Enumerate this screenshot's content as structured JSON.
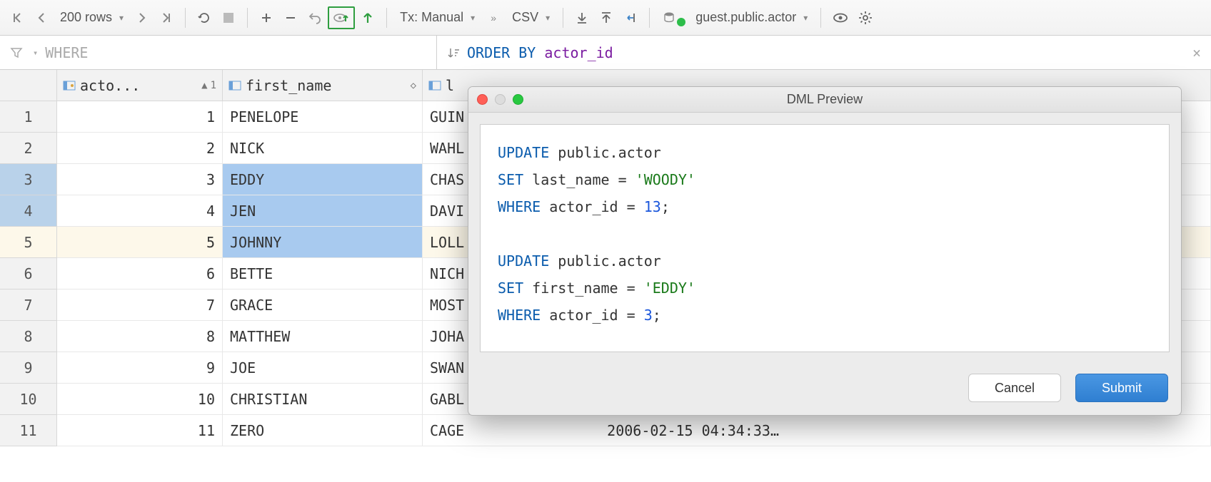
{
  "toolbar": {
    "rows_label": "200 rows",
    "tx_label": "Tx: Manual",
    "export_label": "CSV",
    "datasource": "guest.public.actor"
  },
  "filter": {
    "where_kw": "WHERE",
    "order_kw": "ORDER BY",
    "order_field": "actor_id"
  },
  "columns": {
    "c1": "acto...",
    "c1_sort": "1",
    "c2": "first_name",
    "c3": "l"
  },
  "rows": [
    {
      "n": "1",
      "id": "1",
      "first": "PENELOPE",
      "last": "GUIN",
      "sel": false
    },
    {
      "n": "2",
      "id": "2",
      "first": "NICK",
      "last": "WAHL",
      "sel": false
    },
    {
      "n": "3",
      "id": "3",
      "first": "EDDY",
      "last": "CHAS",
      "sel": true
    },
    {
      "n": "4",
      "id": "4",
      "first": "JEN",
      "last": "DAVI",
      "sel": true
    },
    {
      "n": "5",
      "id": "5",
      "first": "JOHNNY",
      "last": "LOLL",
      "sel": "hover"
    },
    {
      "n": "6",
      "id": "6",
      "first": "BETTE",
      "last": "NICH",
      "sel": false
    },
    {
      "n": "7",
      "id": "7",
      "first": "GRACE",
      "last": "MOST",
      "sel": false
    },
    {
      "n": "8",
      "id": "8",
      "first": "MATTHEW",
      "last": "JOHA",
      "sel": false
    },
    {
      "n": "9",
      "id": "9",
      "first": "JOE",
      "last": "SWAN",
      "sel": false
    },
    {
      "n": "10",
      "id": "10",
      "first": "CHRISTIAN",
      "last": "GABL",
      "sel": false
    },
    {
      "n": "11",
      "id": "11",
      "first": "ZERO",
      "last": "CAGE",
      "sel": false
    }
  ],
  "timestamp": "2006-02-15 04:34:33…",
  "dialog": {
    "title": "DML Preview",
    "sql_tokens": [
      [
        [
          "kw2",
          "UPDATE"
        ],
        [
          "txt",
          " public"
        ],
        [
          "txt",
          ".actor"
        ]
      ],
      [
        [
          "kw2",
          "SET"
        ],
        [
          "txt",
          " last_name = "
        ],
        [
          "str",
          "'WOODY'"
        ]
      ],
      [
        [
          "kw2",
          "WHERE"
        ],
        [
          "txt",
          " actor_id = "
        ],
        [
          "num2",
          "13"
        ],
        [
          "txt",
          ";"
        ]
      ],
      [],
      [
        [
          "kw2",
          "UPDATE"
        ],
        [
          "txt",
          " public"
        ],
        [
          "txt",
          ".actor"
        ]
      ],
      [
        [
          "kw2",
          "SET"
        ],
        [
          "txt",
          " first_name = "
        ],
        [
          "str",
          "'EDDY'"
        ]
      ],
      [
        [
          "kw2",
          "WHERE"
        ],
        [
          "txt",
          " actor_id = "
        ],
        [
          "num2",
          "3"
        ],
        [
          "txt",
          ";"
        ]
      ]
    ],
    "cancel": "Cancel",
    "submit": "Submit"
  }
}
